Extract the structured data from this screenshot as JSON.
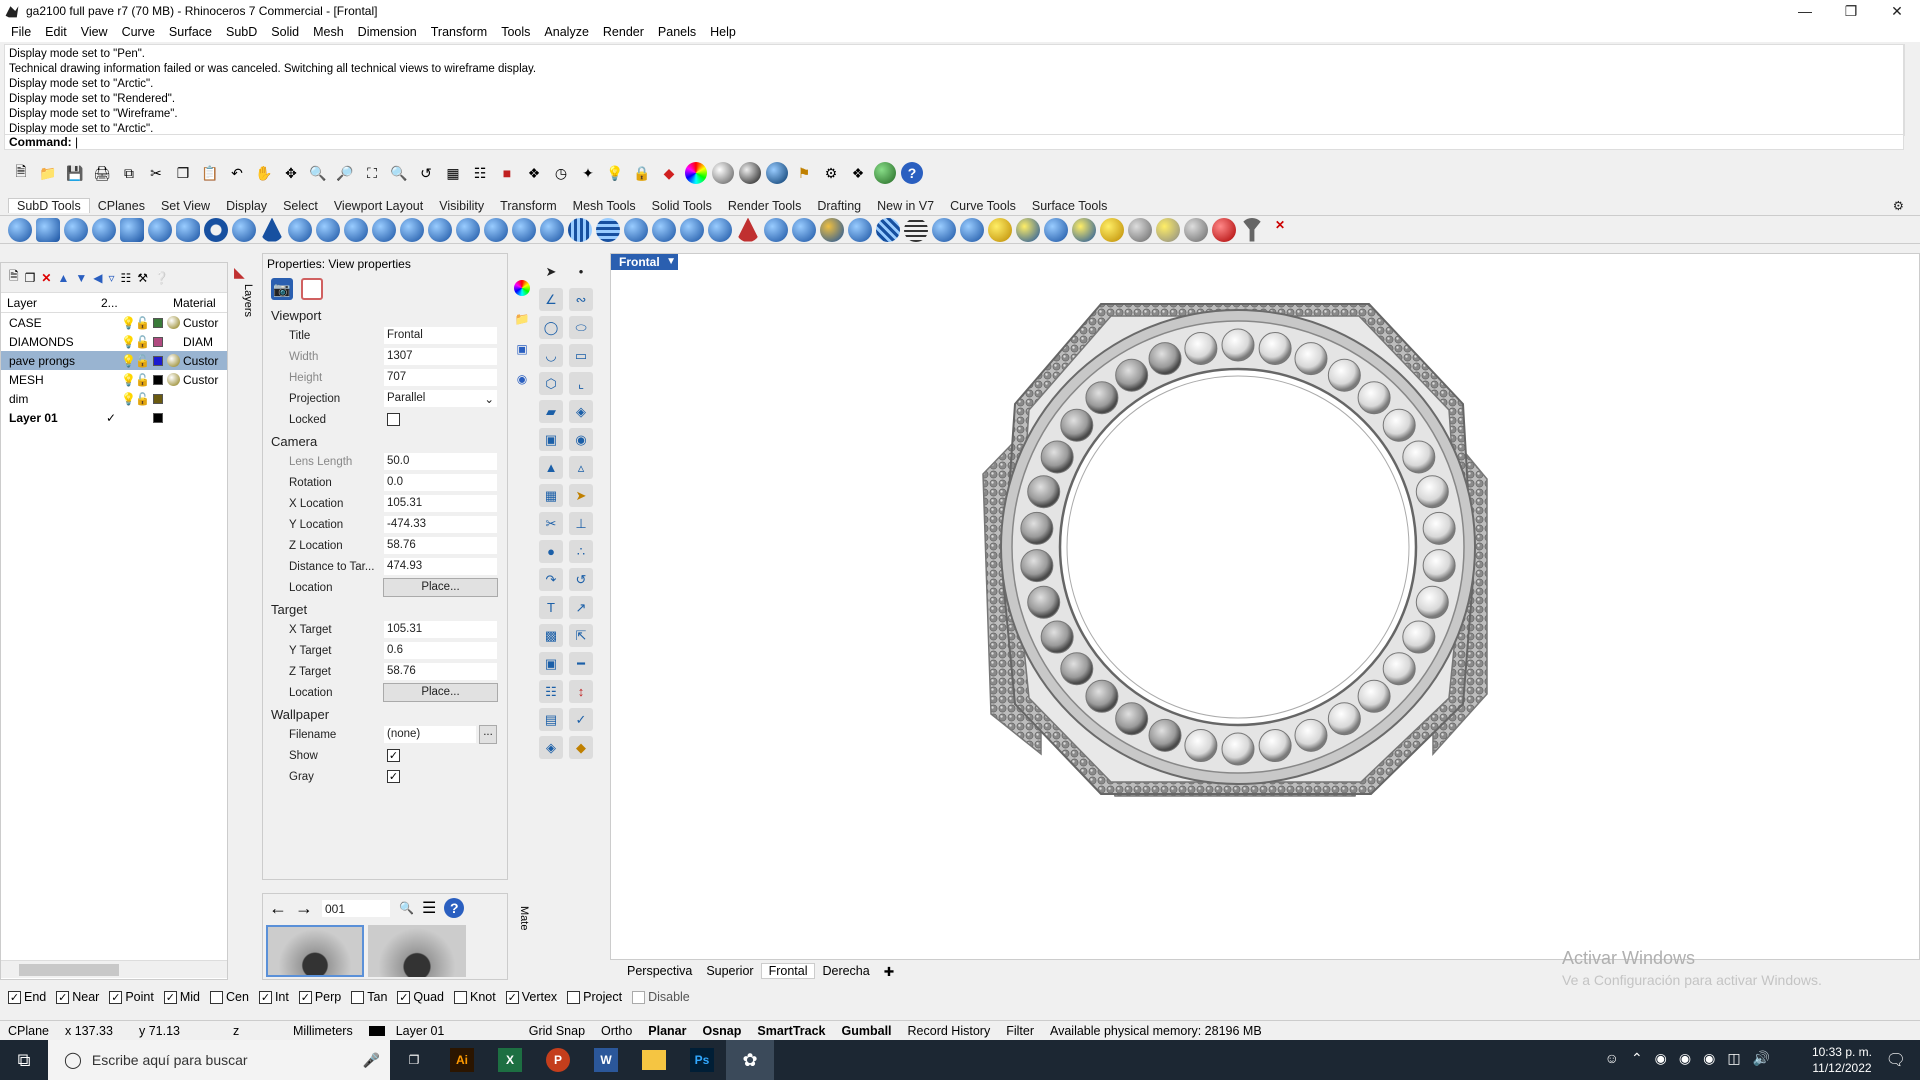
{
  "window": {
    "title": "ga2100 full pave r7 (70 MB) - Rhinoceros 7 Commercial - [Frontal]"
  },
  "menu": [
    "File",
    "Edit",
    "View",
    "Curve",
    "Surface",
    "SubD",
    "Solid",
    "Mesh",
    "Dimension",
    "Transform",
    "Tools",
    "Analyze",
    "Render",
    "Panels",
    "Help"
  ],
  "history": [
    "Display mode set to \"Pen\".",
    "Technical drawing information failed or was canceled. Switching all technical views to wireframe display.",
    "Display mode set to \"Arctic\".",
    "Display mode set to \"Rendered\".",
    "Display mode set to \"Wireframe\".",
    "Display mode set to \"Arctic\"."
  ],
  "command": {
    "label": "Command:"
  },
  "tabs": [
    "SubD Tools",
    "CPlanes",
    "Set View",
    "Display",
    "Select",
    "Viewport Layout",
    "Visibility",
    "Transform",
    "Mesh Tools",
    "Solid Tools",
    "Render Tools",
    "Drafting",
    "New in V7",
    "Curve Tools",
    "Surface Tools"
  ],
  "layers": {
    "headers": {
      "layer": "Layer",
      "current": "2...",
      "material": "Material"
    },
    "side_label": "Layers",
    "rows": [
      {
        "name": "CASE",
        "color": "#3a7a3a",
        "ball": "#8a7a10",
        "material": "Custor"
      },
      {
        "name": "DIAMONDS",
        "color": "#b04a80",
        "ball": "#ffffff",
        "material": "DIAM"
      },
      {
        "name": "pave prongs",
        "color": "#1a1ad0",
        "ball": "#8a7a10",
        "material": "Custor"
      },
      {
        "name": "MESH",
        "color": "#000000",
        "ball": "#8a7a10",
        "material": "Custor"
      },
      {
        "name": "dim",
        "color": "#6a5a10",
        "ball": "",
        "material": ""
      },
      {
        "name": "Layer 01",
        "color": "#000000",
        "ball": "",
        "material": ""
      }
    ]
  },
  "properties": {
    "title": "Properties: View properties",
    "viewport": {
      "heading": "Viewport",
      "title_label": "Title",
      "title": "Frontal",
      "width_label": "Width",
      "width": "1307",
      "height_label": "Height",
      "height": "707",
      "projection_label": "Projection",
      "projection": "Parallel",
      "locked_label": "Locked"
    },
    "camera": {
      "heading": "Camera",
      "lens_label": "Lens Length",
      "lens": "50.0",
      "rotation_label": "Rotation",
      "rotation": "0.0",
      "x_label": "X Location",
      "x": "105.31",
      "y_label": "Y Location",
      "y": "-474.33",
      "z_label": "Z Location",
      "z": "58.76",
      "dist_label": "Distance to Tar...",
      "dist": "474.93",
      "loc_label": "Location",
      "loc_btn": "Place..."
    },
    "target": {
      "heading": "Target",
      "x_label": "X Target",
      "x": "105.31",
      "y_label": "Y Target",
      "y": "0.6",
      "z_label": "Z Target",
      "z": "58.76",
      "loc_label": "Location",
      "loc_btn": "Place..."
    },
    "wallpaper": {
      "heading": "Wallpaper",
      "file_label": "Filename",
      "file": "(none)",
      "browse": "...",
      "show_label": "Show",
      "gray_label": "Gray"
    }
  },
  "browser": {
    "search_value": "001",
    "side_label": "Mate"
  },
  "viewport": {
    "name": "Frontal"
  },
  "view_tabs": [
    "Perspectiva",
    "Superior",
    "Frontal",
    "Derecha"
  ],
  "osnap": [
    {
      "label": "End",
      "on": true
    },
    {
      "label": "Near",
      "on": true
    },
    {
      "label": "Point",
      "on": true
    },
    {
      "label": "Mid",
      "on": true
    },
    {
      "label": "Cen",
      "on": false
    },
    {
      "label": "Int",
      "on": true
    },
    {
      "label": "Perp",
      "on": true
    },
    {
      "label": "Tan",
      "on": false
    },
    {
      "label": "Quad",
      "on": true
    },
    {
      "label": "Knot",
      "on": false
    },
    {
      "label": "Vertex",
      "on": true
    },
    {
      "label": "Project",
      "on": false
    },
    {
      "label": "Disable",
      "on": false
    }
  ],
  "status": {
    "cplane": "CPlane",
    "x": "x 137.33",
    "y": "y 71.13",
    "z": "z",
    "units": "Millimeters",
    "layer": "Layer 01",
    "toggles": [
      "Grid Snap",
      "Ortho",
      "Planar",
      "Osnap",
      "SmartTrack",
      "Gumball",
      "Record History",
      "Filter"
    ],
    "memory": "Available physical memory: 28196 MB"
  },
  "watermark": {
    "line1": "Activar Windows",
    "line2": "Ve a Configuración para activar Windows."
  },
  "taskbar": {
    "search": "Escribe aquí para buscar",
    "time": "10:33 p. m.",
    "date": "11/12/2022"
  }
}
